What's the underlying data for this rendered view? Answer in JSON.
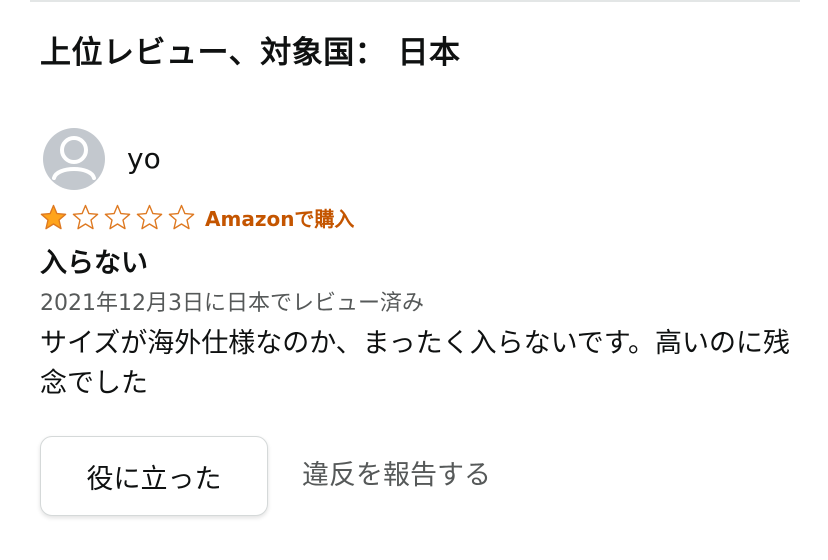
{
  "section": {
    "title": "上位レビュー、対象国： 日本"
  },
  "review": {
    "reviewer": {
      "name": "yo",
      "avatar_icon": "default-profile-icon"
    },
    "rating": {
      "value": 1,
      "max": 5,
      "filled_color": "#ffa41c",
      "outline_color": "#de7921"
    },
    "purchase_badge": "Amazonで購入",
    "title": "入らない",
    "date": "2021年12月3日に日本でレビュー済み",
    "body": "サイズが海外仕様なのか、まったく入らないです。高いのに残念でした"
  },
  "actions": {
    "helpful_label": "役に立った",
    "report_label": "違反を報告する"
  },
  "colors": {
    "badge": "#c45500",
    "secondary_text": "#565959",
    "avatar_bg": "#c3c8ce"
  }
}
